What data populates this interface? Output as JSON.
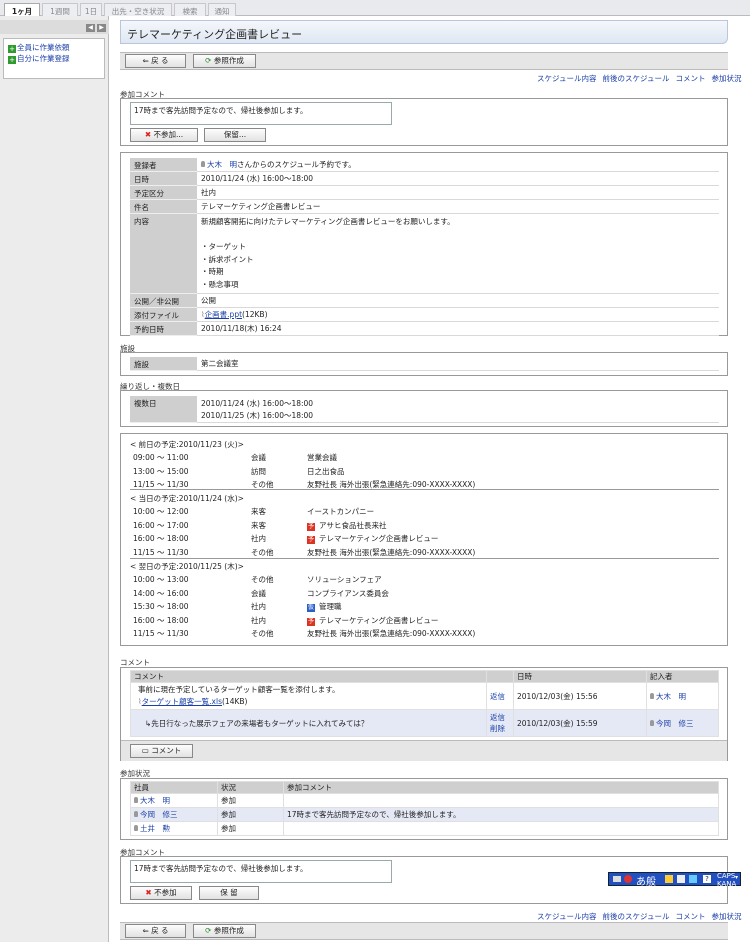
{
  "tabs": [
    "1ヶ月",
    "1週間",
    "1日",
    "出先・空き状況",
    "検索",
    "通知"
  ],
  "sidebar": {
    "items": [
      "全員に作業依頼",
      "自分に作業登録"
    ]
  },
  "page_title": "テレマーケティング企画書レビュー",
  "buttons": {
    "back": "戻 る",
    "ref": "参照作成"
  },
  "links": [
    "スケジュール内容",
    "前後のスケジュール",
    "コメント",
    "参加状況"
  ],
  "participation": {
    "label": "参加コメント",
    "comment": "17時まで客先訪問予定なので、帰社後参加します。",
    "decline": "不参加...",
    "hold": "保留...",
    "decline_bottom": "不参加",
    "hold_bottom": "保 留"
  },
  "details": {
    "rows": [
      {
        "label": "登録者",
        "value": "さんからのスケジュール予約です。",
        "person": "大木　明"
      },
      {
        "label": "日時",
        "value": "2010/11/24 (水) 16:00～18:00"
      },
      {
        "label": "予定区分",
        "value": "社内"
      },
      {
        "label": "件名",
        "value": "テレマーケティング企画書レビュー"
      },
      {
        "label": "内容",
        "value": "新規顧客開拓に向けたテレマーケティング企画書レビューをお願いします。",
        "bullets": [
          "・ターゲット",
          "・訴求ポイント",
          "・時期",
          "・懸念事項"
        ]
      },
      {
        "label": "公開／非公開",
        "value": "公開"
      },
      {
        "label": "添付ファイル",
        "value": "(12KB)",
        "file": "企画書.ppt"
      },
      {
        "label": "予約日時",
        "value": "2010/11/18(木) 16:24"
      }
    ]
  },
  "facility": {
    "label": "施設",
    "name": "施設",
    "value": "第二会議室"
  },
  "repeat": {
    "label": "繰り返し・複数日",
    "name": "複数日",
    "dates": [
      "2010/11/24 (水) 16:00～18:00",
      "2010/11/25 (木) 16:00～18:00"
    ]
  },
  "nearby": [
    {
      "header": "< 前日の予定:2010/11/23 (火)>",
      "rows": [
        [
          "09:00 ～ 11:00",
          "会議",
          "",
          "営業会議"
        ],
        [
          "13:00 ～ 15:00",
          "訪問",
          "",
          "日之出食品"
        ],
        [
          "11/15 ～ 11/30",
          "その他",
          "",
          "友野社長 海外出張(緊急連絡先:090-XXXX-XXXX)"
        ]
      ]
    },
    {
      "header": "< 当日の予定:2010/11/24 (水)>",
      "rows": [
        [
          "10:00 ～ 12:00",
          "来客",
          "",
          "イーストカンパニー"
        ],
        [
          "16:00 ～ 17:00",
          "来客",
          "予",
          "アサヒ食品社長来社"
        ],
        [
          "16:00 ～ 18:00",
          "社内",
          "予",
          "テレマーケティング企画書レビュー"
        ],
        [
          "11/15 ～ 11/30",
          "その他",
          "",
          "友野社長 海外出張(緊急連絡先:090-XXXX-XXXX)"
        ]
      ]
    },
    {
      "header": "< 翌日の予定:2010/11/25 (木)>",
      "rows": [
        [
          "10:00 ～ 13:00",
          "その他",
          "",
          "ソリューションフェア"
        ],
        [
          "14:00 ～ 16:00",
          "会議",
          "",
          "コンプライアンス委員会"
        ],
        [
          "15:30 ～ 18:00",
          "社内",
          "仮",
          "管理職"
        ],
        [
          "16:00 ～ 18:00",
          "社内",
          "予",
          "テレマーケティング企画書レビュー"
        ],
        [
          "11/15 ～ 11/30",
          "その他",
          "",
          "友野社長 海外出張(緊急連絡先:090-XXXX-XXXX)"
        ]
      ]
    }
  ],
  "comments": {
    "label": "コメント",
    "headers": [
      "コメント",
      "",
      "日時",
      "記入者"
    ],
    "rows": [
      {
        "text": "事前に現在予定しているターゲット顧客一覧を添付します。",
        "file": "ターゲット顧客一覧.xls",
        "size": "(14KB)",
        "actions": [
          "返信"
        ],
        "date": "2010/12/03(金) 15:56",
        "author": "大木　明"
      },
      {
        "text": "↳先日行なった展示フェアの来場者もターゲットに入れてみては？",
        "actions": [
          "返信",
          "削除"
        ],
        "date": "2010/12/03(金) 15:59",
        "author": "今岡　修三"
      }
    ],
    "button": "コメント"
  },
  "status": {
    "label": "参加状況",
    "headers": [
      "社員",
      "状況",
      "参加コメント"
    ],
    "rows": [
      {
        "name": "大木　明",
        "status": "参加",
        "comment": ""
      },
      {
        "name": "今岡　修三",
        "status": "参加",
        "comment": "17時まで客先訪問予定なので、帰社後参加します。"
      },
      {
        "name": "土井　勲",
        "status": "参加",
        "comment": ""
      }
    ]
  },
  "ime": {
    "mode": "あ般",
    "caps": "CAPS",
    "kana": "KANA"
  }
}
